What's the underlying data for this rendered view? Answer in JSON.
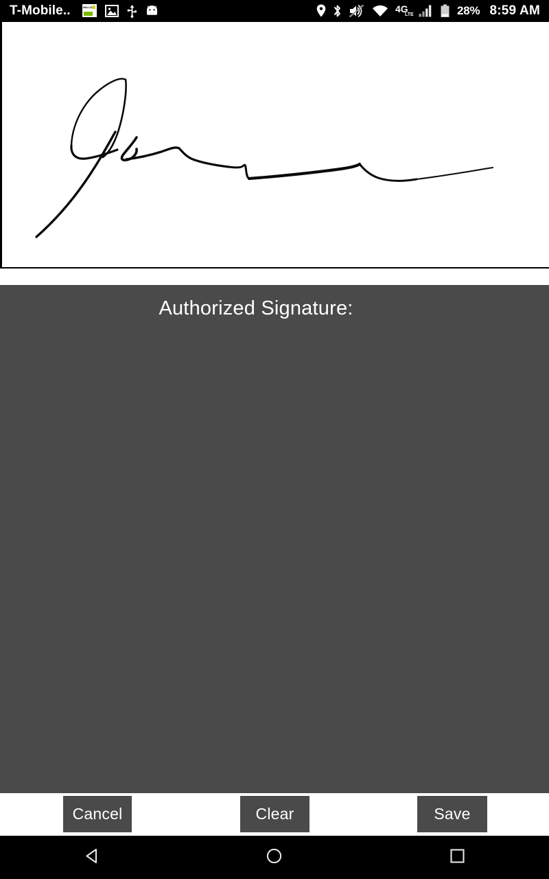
{
  "status_bar": {
    "carrier": "T-Mobile..",
    "battery_percent": "28%",
    "time": "8:59 AM",
    "left_icons": [
      {
        "name": "app-notification-icon",
        "label": "app-badge"
      },
      {
        "name": "image-icon",
        "label": "photo"
      },
      {
        "name": "usb-icon",
        "label": "usb"
      },
      {
        "name": "android-head-icon",
        "label": "android"
      }
    ],
    "right_icons": [
      {
        "name": "location-pin-icon",
        "label": "location"
      },
      {
        "name": "bluetooth-icon",
        "label": "bluetooth"
      },
      {
        "name": "volume-mute-icon",
        "label": "muted"
      },
      {
        "name": "wifi-icon",
        "label": "wifi"
      },
      {
        "name": "network-4g-lte-icon",
        "label": "4G LTE"
      },
      {
        "name": "signal-bars-icon",
        "label": "signal"
      },
      {
        "name": "battery-icon",
        "label": "battery"
      }
    ],
    "network_label": "4G",
    "network_sub_label": "LTE"
  },
  "signature_canvas": {
    "name": "signature-drawing-area",
    "background_color": "#ffffff",
    "stroke_color": "#0a0a0a",
    "has_signature": true
  },
  "panel": {
    "title": "Authorized Signature:",
    "background_color": "#4a4a4a",
    "text_color": "#ffffff"
  },
  "buttons": {
    "cancel_label": "Cancel",
    "clear_label": "Clear",
    "save_label": "Save",
    "background_color": "#4a4a4a",
    "bar_background": "#ffffff"
  },
  "nav_bar": {
    "background_color": "#000000",
    "items": [
      {
        "name": "nav-back-button",
        "label": "Back"
      },
      {
        "name": "nav-home-button",
        "label": "Home"
      },
      {
        "name": "nav-recents-button",
        "label": "Recents"
      }
    ]
  }
}
